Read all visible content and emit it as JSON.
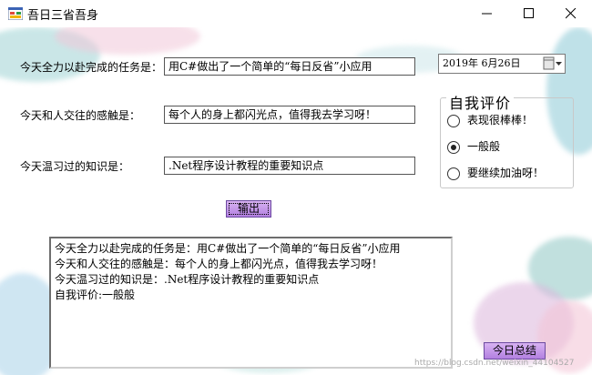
{
  "window": {
    "title": "吾日三省吾身",
    "controls": [
      "minimize",
      "maximize",
      "close"
    ]
  },
  "form": {
    "task_label": "今天全力以赴完成的任务是：",
    "task_value": "用C#做出了一个简单的“每日反省”小应用",
    "feeling_label": "今天和人交往的感触是：",
    "feeling_value": "每个人的身上都闪光点，值得我去学习呀！",
    "knowledge_label": "今天温习过的知识是：",
    "knowledge_value": ".Net程序设计教程的重要知识点",
    "date_value": "2019年  6月26日"
  },
  "evaluation": {
    "title": "自我评价",
    "options": [
      "表现很棒棒！",
      "一般般",
      "要继续加油呀！"
    ],
    "selected": "一般般"
  },
  "buttons": {
    "output_label": "输出",
    "summary_label": "今日总结"
  },
  "output": {
    "lines": [
      "今天全力以赴完成的任务是：用C#做出了一个简单的“每日反省”小应用",
      "今天和人交往的感触是：每个人的身上都闪光点，值得我去学习呀！",
      "今天温习过的知识是：.Net程序设计教程的重要知识点",
      "自我评价:一般般"
    ]
  },
  "watermark": "https://blog.csdn.net/weixin_44104527",
  "colors": {
    "button_fill": "#c89af0",
    "splash_teal": "#7fc6c8",
    "splash_pink": "#e7a9c8"
  }
}
